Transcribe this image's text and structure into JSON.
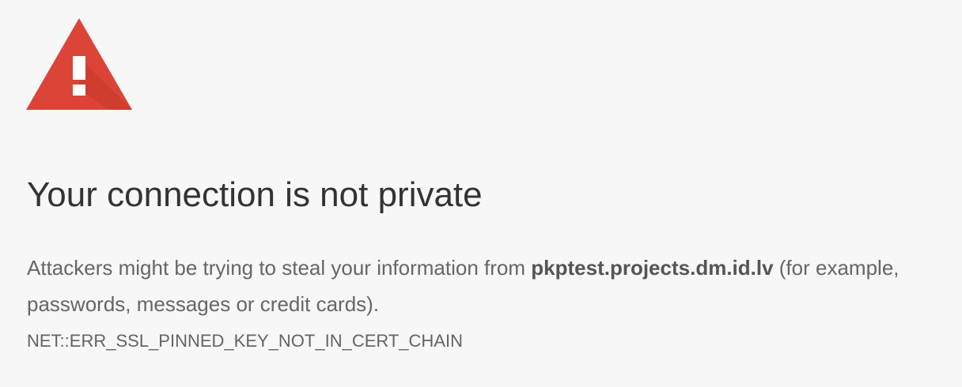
{
  "icon": {
    "name": "warning-triangle-icon",
    "color": "#db4437",
    "glyph_color": "#ffffff"
  },
  "title": "Your connection is not private",
  "description": {
    "prefix": "Attackers might be trying to steal your information from ",
    "host": "pkptest.projects.dm.id.lv",
    "suffix": " (for example, passwords, messages or credit cards)."
  },
  "error_code": "NET::ERR_SSL_PINNED_KEY_NOT_IN_CERT_CHAIN",
  "colors": {
    "background": "#f7f7f7",
    "title": "#333333",
    "body_text": "#666666"
  }
}
